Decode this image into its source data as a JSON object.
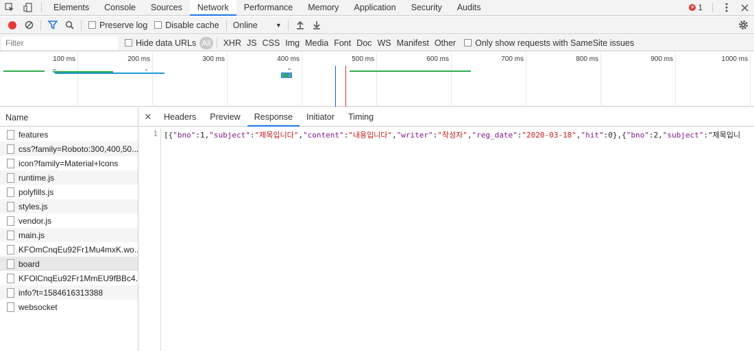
{
  "tabs": [
    "Elements",
    "Console",
    "Sources",
    "Network",
    "Performance",
    "Memory",
    "Application",
    "Security",
    "Audits"
  ],
  "active_tab": "Network",
  "error_count": "1",
  "toolbar": {
    "preserve_log": "Preserve log",
    "disable_cache": "Disable cache",
    "throttle": "Online"
  },
  "filter": {
    "placeholder": "Filter",
    "hide_data_urls": "Hide data URLs",
    "types": [
      "All",
      "XHR",
      "JS",
      "CSS",
      "Img",
      "Media",
      "Font",
      "Doc",
      "WS",
      "Manifest",
      "Other"
    ],
    "samesite": "Only show requests with SameSite issues"
  },
  "overview": {
    "ticks": [
      "100 ms",
      "200 ms",
      "300 ms",
      "400 ms",
      "500 ms",
      "600 ms",
      "700 ms",
      "800 ms",
      "900 ms",
      "1000 ms"
    ]
  },
  "requests": {
    "header": "Name",
    "items": [
      "features",
      "css?family=Roboto:300,400,50...",
      "icon?family=Material+Icons",
      "runtime.js",
      "polyfills.js",
      "styles.js",
      "vendor.js",
      "main.js",
      "KFOmCnqEu92Fr1Mu4mxK.wo...",
      "board",
      "KFOlCnqEu92Fr1MmEU9fBBc4...",
      "info?t=1584616313388",
      "websocket"
    ]
  },
  "detail": {
    "tabs": [
      "Headers",
      "Preview",
      "Response",
      "Initiator",
      "Timing"
    ],
    "active": "Response",
    "line_number": "1",
    "response": "[{\"bno\":1,\"subject\":\"제목입니다\",\"content\":\"내용입니다\",\"writer\":\"작성자\",\"reg_date\":\"2020-03-18\",\"hit\":0},{\"bno\":2,\"subject\":\"제목입니"
  },
  "colors": {
    "accent": "#1a73e8",
    "record": "#e53935",
    "key": "#881391",
    "string": "#c41a16"
  }
}
